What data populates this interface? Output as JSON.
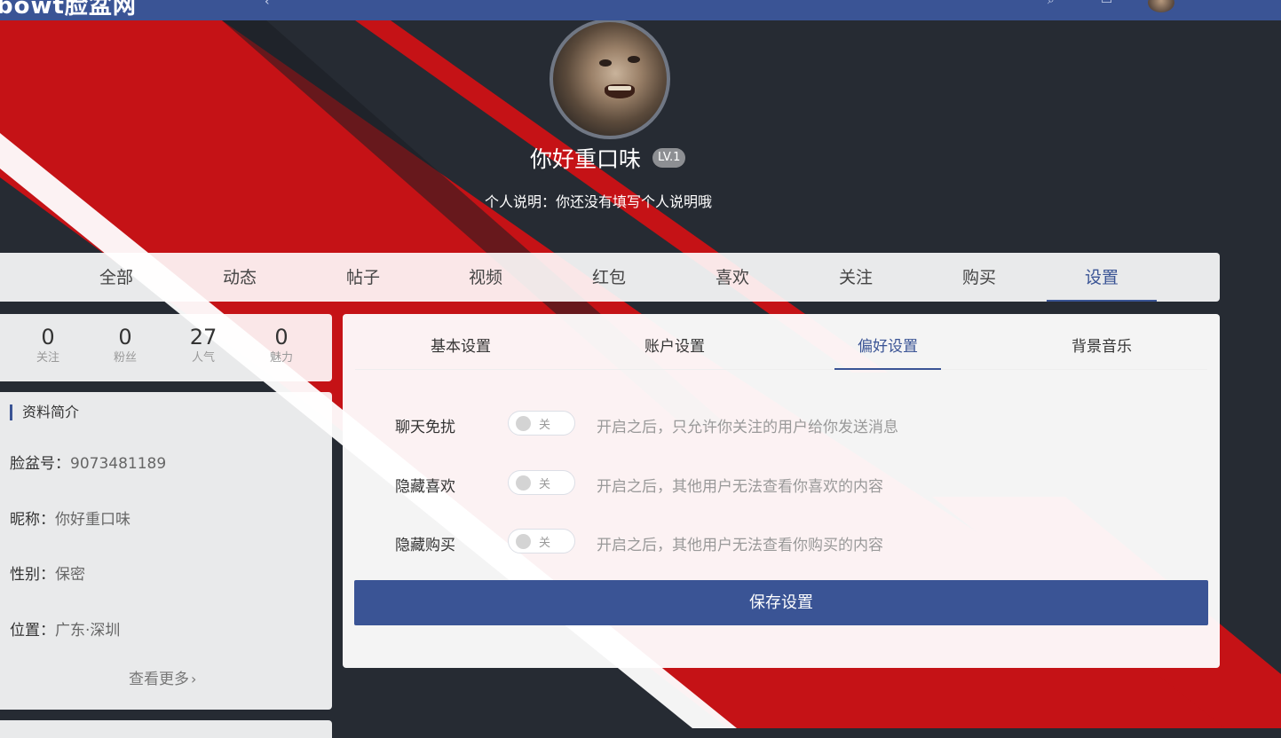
{
  "header": {
    "logo_text": "bowt脸盆网",
    "icons": [
      "chevron-left-icon",
      "search-icon",
      "message-icon"
    ]
  },
  "profile": {
    "username": "你好重口味",
    "level": "LV.1",
    "bio": "个人说明：你还没有填写个人说明哦"
  },
  "main_tabs": [
    {
      "label": "全部"
    },
    {
      "label": "动态"
    },
    {
      "label": "帖子"
    },
    {
      "label": "视频"
    },
    {
      "label": "红包"
    },
    {
      "label": "喜欢"
    },
    {
      "label": "关注"
    },
    {
      "label": "购买"
    },
    {
      "label": "设置",
      "active": true
    }
  ],
  "stats": [
    {
      "value": "0",
      "label": "关注"
    },
    {
      "value": "0",
      "label": "粉丝"
    },
    {
      "value": "27",
      "label": "人气"
    },
    {
      "value": "0",
      "label": "魅力"
    }
  ],
  "profile_card": {
    "title": "资料简介",
    "rows": [
      {
        "key": "脸盆号：",
        "value": "9073481189"
      },
      {
        "key": "昵称：",
        "value": "你好重口味"
      },
      {
        "key": "性别：",
        "value": "保密"
      },
      {
        "key": "位置：",
        "value": "广东·深圳"
      }
    ],
    "more_label": "查看更多",
    "more_chevron": "›"
  },
  "settings": {
    "sub_tabs": [
      {
        "label": "基本设置"
      },
      {
        "label": "账户设置"
      },
      {
        "label": "偏好设置",
        "active": true
      },
      {
        "label": "背景音乐"
      }
    ],
    "preferences": [
      {
        "label": "聊天免扰",
        "state": "关",
        "enabled": false,
        "description": "开启之后，只允许你关注的用户给你发送消息"
      },
      {
        "label": "隐藏喜欢",
        "state": "关",
        "enabled": false,
        "description": "开启之后，其他用户无法查看你喜欢的内容"
      },
      {
        "label": "隐藏购买",
        "state": "关",
        "enabled": false,
        "description": "开启之后，其他用户无法查看你购买的内容"
      }
    ],
    "save_label": "保存设置"
  },
  "colors": {
    "accent": "#3a5495",
    "background_dark": "#262b33",
    "background_red": "#c51216",
    "text_muted": "#999999"
  }
}
